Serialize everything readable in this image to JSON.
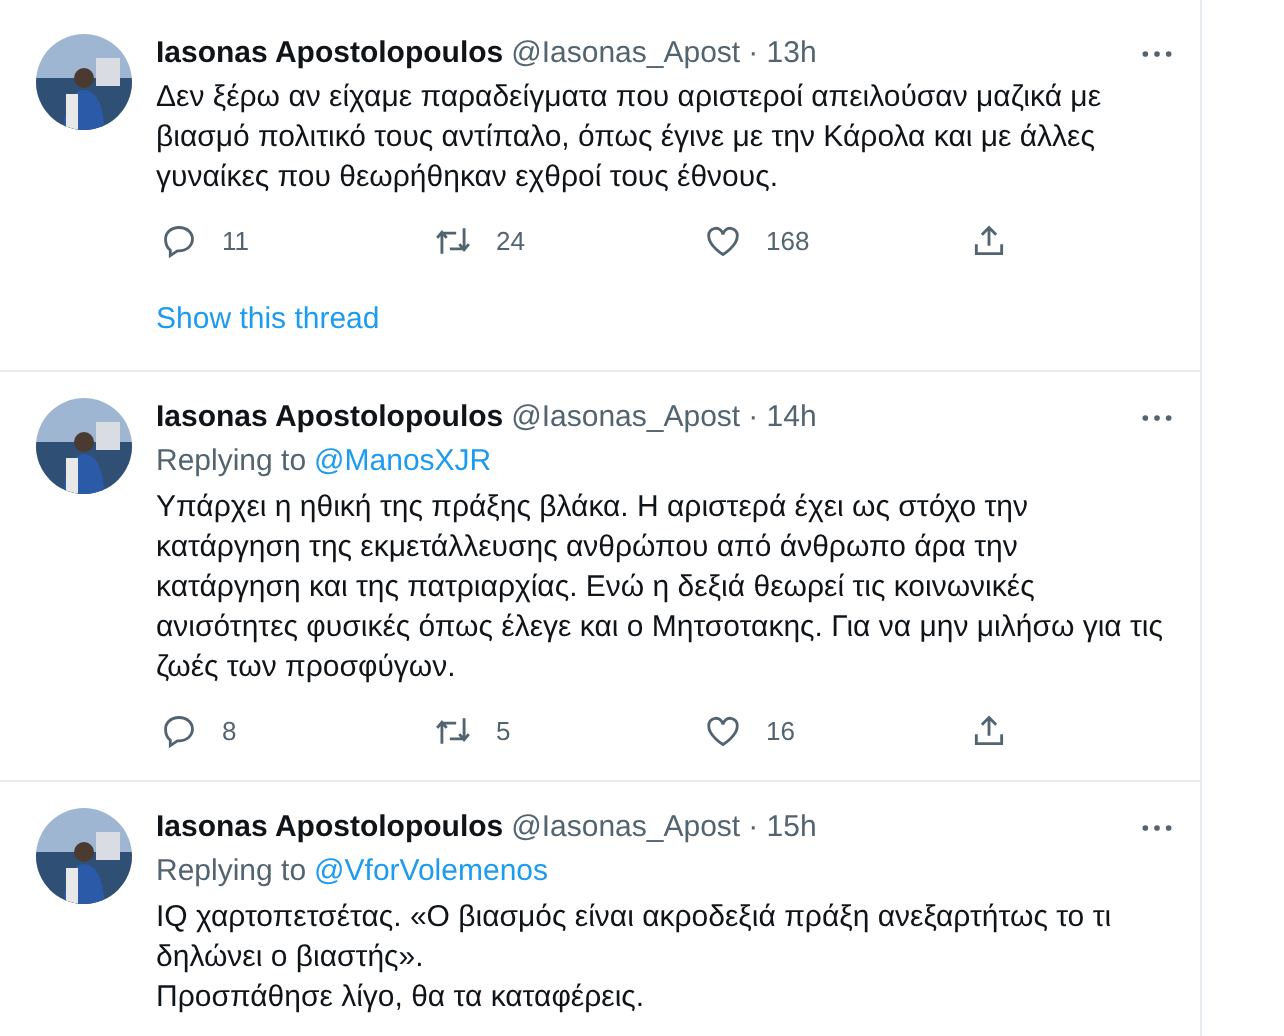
{
  "tweets": [
    {
      "name": "Iasonas Apostolopoulos",
      "handle": "@Iasonas_Apost",
      "time": "· 13h",
      "text": "Δεν ξέρω αν είχαμε παραδείγματα που αριστεροί απειλούσαν μαζικά με βιασμό πολιτικό τους αντίπαλο, όπως έγινε με την Κάρολα και με άλλες γυναίκες που θεωρήθηκαν εχθροί τους έθνους.",
      "replies": "11",
      "retweets": "24",
      "likes": "168",
      "show_thread": "Show this thread"
    },
    {
      "name": "Iasonas Apostolopoulos",
      "handle": "@Iasonas_Apost",
      "time": "· 14h",
      "replying_to": {
        "label": "Replying to",
        "user": "@ManosXJR"
      },
      "text": "Υπάρχει η ηθική της πράξης βλάκα. Η αριστερά έχει ως στόχο την κατάργηση της εκμετάλλευσης ανθρώπου από άνθρωπο άρα την κατάργηση και της πατριαρχίας. Ενώ η δεξιά θεωρεί τις κοινωνικές ανισότητες φυσικές όπως έλεγε και ο Μητσοτακης. Για να μην μιλήσω για τις ζωές των προσφύγων.",
      "replies": "8",
      "retweets": "5",
      "likes": "16"
    },
    {
      "name": "Iasonas Apostolopoulos",
      "handle": "@Iasonas_Apost",
      "time": "· 15h",
      "replying_to": {
        "label": "Replying to",
        "user": "@VforVolemenos"
      },
      "text": "IQ χαρτοπετσέτας. «Ο βιασμός είναι ακροδεξιά πράξη ανεξαρτήτως το τι δηλώνει ο βιαστής».\nΠροσπάθησε λίγο, θα τα καταφέρεις."
    }
  ]
}
